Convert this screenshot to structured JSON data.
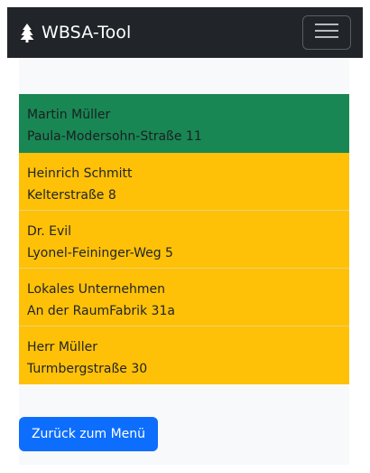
{
  "navbar": {
    "brand": "WBSA-Tool",
    "brand_icon": "tree-icon",
    "toggler_icon": "hamburger-menu-icon"
  },
  "entries": [
    {
      "name": "Martin Müller",
      "address": "Paula-Modersohn-Straße 11",
      "status_color": "#198754"
    },
    {
      "name": "Heinrich Schmitt",
      "address": "Kelterstraße 8",
      "status_color": "#ffc107"
    },
    {
      "name": "Dr. Evil",
      "address": "Lyonel-Feininger-Weg 5",
      "status_color": "#ffc107"
    },
    {
      "name": "Lokales Unternehmen",
      "address": "An der RaumFabrik 31a",
      "status_color": "#ffc107"
    },
    {
      "name": "Herr Müller",
      "address": "Turmbergstraße 30",
      "status_color": "#ffc107"
    }
  ],
  "back_button": {
    "label": "Zurück zum Menü"
  }
}
